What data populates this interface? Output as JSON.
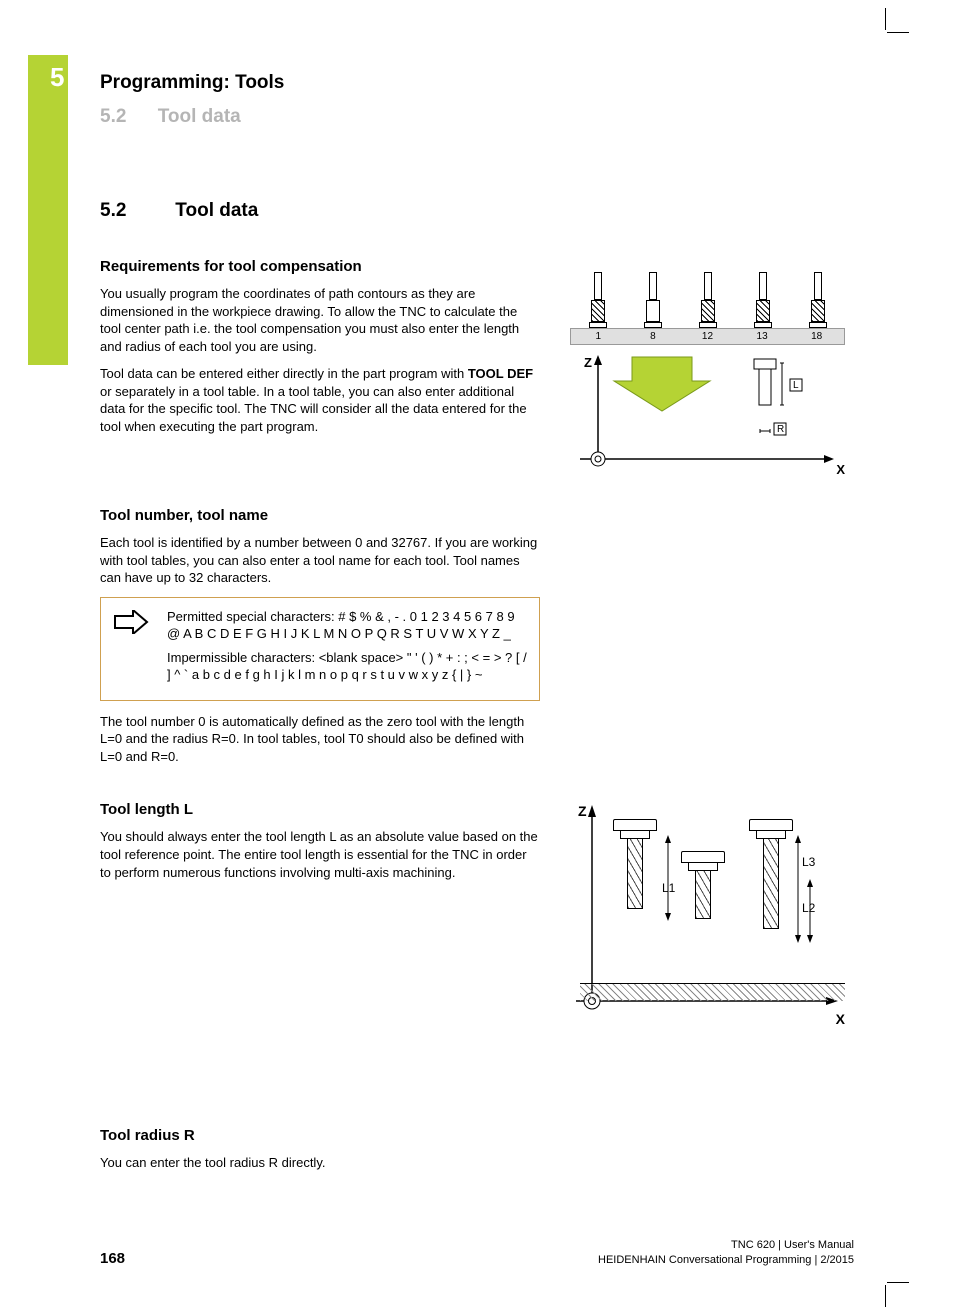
{
  "chapter": {
    "num": "5",
    "title": "Programming: Tools"
  },
  "running_head": {
    "num": "5.2",
    "title": "Tool data"
  },
  "section": {
    "num": "5.2",
    "title": "Tool data"
  },
  "req": {
    "heading": "Requirements for tool compensation",
    "p1": "You usually program the coordinates of path contours as they are dimensioned in the workpiece drawing. To allow the TNC to calculate the tool center path i.e. the tool compensation you must also enter the length and radius of each tool you are using.",
    "p2a": "Tool data can be entered either directly in the part program with ",
    "p2bold": "TOOL DEF",
    "p2b": " or separately in a tool table. In a tool table, you can also enter additional data for the specific tool. The TNC will consider all the data entered for the tool when executing the part program."
  },
  "toolnum": {
    "heading": "Tool number, tool name",
    "p1": "Each tool is identified by a number between 0 and 32767. If you are working with tool tables, you can also enter a tool name for each tool. Tool names can have up to 32 characters.",
    "note1": "Permitted special characters: # $ % & , - . 0 1 2 3 4 5 6 7 8 9 @ A B C D E F G H I J K L M N O P Q R S T U V W X Y Z _",
    "note2": "Impermissible characters: <blank space> \" ' ( ) * + : ; < = > ? [ / ] ^ ` a b c d e f g h I j k l m n o p q r s t u v w x y z { | } ~",
    "p2": "The tool number 0 is automatically defined as the zero tool with the length L=0 and the radius R=0. In tool tables, tool T0 should also be defined with L=0 and R=0."
  },
  "length": {
    "heading": "Tool length L",
    "p1": "You should always enter the tool length L as an absolute value based on the tool reference point. The entire tool length is essential for the TNC in order to perform numerous functions involving multi-axis machining."
  },
  "radius": {
    "heading": "Tool radius R",
    "p1": "You can enter the tool radius R directly."
  },
  "diag1": {
    "labels": [
      "1",
      "8",
      "12",
      "13",
      "18"
    ],
    "axis_z": "Z",
    "axis_x": "X",
    "mark_l": "L",
    "mark_r": "R"
  },
  "diag2": {
    "axis_z": "Z",
    "axis_x": "X",
    "l1": "L1",
    "l2": "L2",
    "l3": "L3"
  },
  "footer": {
    "page": "168",
    "line1": "TNC 620 | User's Manual",
    "line2": "HEIDENHAIN Conversational Programming | 2/2015"
  }
}
